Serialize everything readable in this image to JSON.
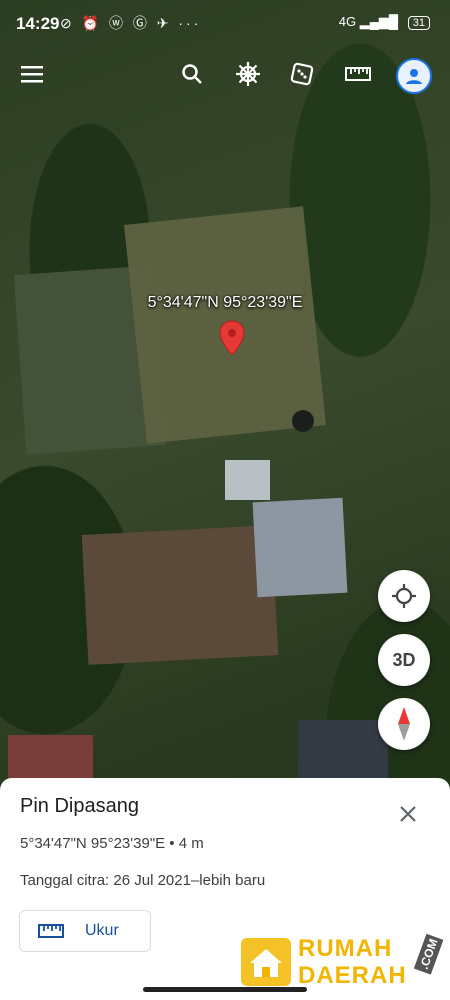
{
  "status_bar": {
    "time": "14:29",
    "notification_icons": "⊘ ⏰ ⓦ Ⓖ ✈ ···",
    "network": "4G ▂▄▆█",
    "battery": "31"
  },
  "toolbar": {
    "menu_icon": "menu-icon",
    "search_icon": "search-icon",
    "voyager_icon": "ship-wheel-icon",
    "feeling_lucky_icon": "dice-icon",
    "measure_icon": "ruler-icon",
    "account_icon": "account-icon"
  },
  "map": {
    "pin_label": "5°34'47\"N 95°23'39\"E",
    "pin_color": "#e53935"
  },
  "fabs": {
    "locate_icon": "my-location-icon",
    "view_3d_label": "3D",
    "compass_icon": "compass-icon"
  },
  "info_sheet": {
    "title": "Pin Dipasang",
    "coordinates": "5°34'47\"N 95°23'39\"E • 4 m",
    "imagery_date": "Tanggal citra: 26 Jul 2021–lebih baru",
    "measure_button": "Ukur",
    "close_icon": "close-icon"
  },
  "watermark": {
    "line1": "RUMAH",
    "line2": "DAERAH",
    "suffix": ".COM"
  },
  "colors": {
    "accent_blue": "#1a73e8",
    "watermark_yellow": "#f2b600"
  }
}
